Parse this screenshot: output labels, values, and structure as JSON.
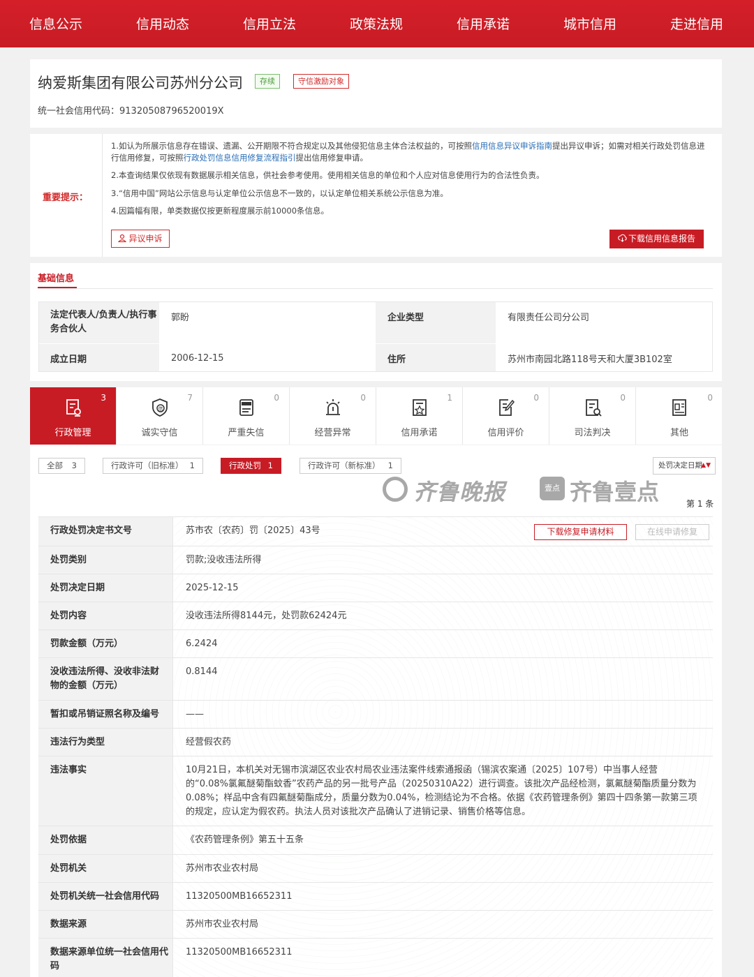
{
  "nav": [
    "信息公示",
    "信用动态",
    "信用立法",
    "政策法规",
    "信用承诺",
    "城市信用",
    "走进信用"
  ],
  "company": {
    "name": "纳爱斯集团有限公司苏州分公司",
    "status_tag": "存续",
    "incentive_tag": "守信激励对象",
    "credit_code_label": "统一社会信用代码：",
    "credit_code": "91320508796520019X"
  },
  "notice": {
    "title": "重要提示：",
    "line1_a": "1.如认为所展示信息存在错误、遗漏、公开期限不符合规定以及其他侵犯信息主体合法权益的，可按照",
    "line1_link": "信用信息异议申诉指南",
    "line1_b": "提出异议申诉；如需对相关行政处罚信息进行信用修复，可按照",
    "line1_link2": "行政处罚信息信用修复流程指引",
    "line1_c": "提出信用修复申请。",
    "line2": "2.本查询结果仅依现有数据展示相关信息，供社会参考使用。使用相关信息的单位和个人应对信息使用行为的合法性负责。",
    "line3": "3.“信用中国”网站公示信息与认定单位公示信息不一致的，以认定单位相关系统公示信息为准。",
    "line4": "4.因篇幅有限，单类数据仅按更新程度展示前10000条信息。",
    "appeal_button": "异议申诉",
    "download_button": "下载信用信息报告"
  },
  "basic": {
    "title": "基础信息",
    "legal_rep_label": "法定代表人/负责人/执行事务合伙人",
    "legal_rep": "郭盼",
    "type_label": "企业类型",
    "type": "有限责任公司分公司",
    "founded_label": "成立日期",
    "founded": "2006-12-15",
    "address_label": "住所",
    "address": "苏州市南园北路118号天和大厦3B102室"
  },
  "categories": [
    {
      "label": "行政管理",
      "count": "3",
      "icon": "document-stamp-icon"
    },
    {
      "label": "诚实守信",
      "count": "7",
      "icon": "shield-credit-icon"
    },
    {
      "label": "严重失信",
      "count": "0",
      "icon": "dishonest-person-icon"
    },
    {
      "label": "经营异常",
      "count": "0",
      "icon": "alarm-light-icon"
    },
    {
      "label": "信用承诺",
      "count": "1",
      "icon": "promise-document-icon"
    },
    {
      "label": "信用评价",
      "count": "0",
      "icon": "evaluation-icon"
    },
    {
      "label": "司法判决",
      "count": "0",
      "icon": "judgment-icon"
    },
    {
      "label": "其他",
      "count": "0",
      "icon": "other-icon"
    }
  ],
  "filters": {
    "all_label": "全部",
    "all_count": "3",
    "old_label": "行政许可（旧标准）",
    "old_count": "1",
    "penalty_label": "行政处罚",
    "penalty_count": "1",
    "new_label": "行政许可（新标准）",
    "new_count": "1",
    "sort": "处罚决定日期"
  },
  "watermark": {
    "brand1": "齐鲁晚报",
    "box": "壹点",
    "brand2": "齐鲁壹点"
  },
  "page_count": "第 1 条",
  "detail": {
    "download_repair": "下载修复申请材料",
    "online_repair": "在线申请修复",
    "rows": [
      {
        "label": "行政处罚决定书文号",
        "value": "苏市农〔农药〕罚〔2025〕43号"
      },
      {
        "label": "处罚类别",
        "value": "罚款;没收违法所得"
      },
      {
        "label": "处罚决定日期",
        "value": "2025-12-15"
      },
      {
        "label": "处罚内容",
        "value": "没收违法所得8144元，处罚款62424元"
      },
      {
        "label": "罚款金额（万元）",
        "value": "6.2424"
      },
      {
        "label": "没收违法所得、没收非法财物的金额（万元）",
        "value": "0.8144"
      },
      {
        "label": "暂扣或吊销证照名称及编号",
        "value": "——"
      },
      {
        "label": "违法行为类型",
        "value": "经营假农药"
      },
      {
        "label": "违法事实",
        "value": "10月21日，本机关对无锡市滨湖区农业农村局农业违法案件线索通报函（锡滨农案通〔2025〕107号）中当事人经营的“0.08%氯氟醚菊酯蚊香”农药产品的另一批号产品（20250310A22）进行调查。该批次产品经检测，氯氟醚菊酯质量分数为0.08%；样品中含有四氟醚菊酯成分，质量分数为0.04%，检测结论为不合格。依据《农药管理条例》第四十四条第一款第三项的规定，应认定为假农药。执法人员对该批次产品确认了进销记录、销售价格等信息。"
      },
      {
        "label": "处罚依据",
        "value": "《农药管理条例》第五十五条"
      },
      {
        "label": "处罚机关",
        "value": "苏州市农业农村局"
      },
      {
        "label": "处罚机关统一社会信用代码",
        "value": "11320500MB16652311"
      },
      {
        "label": "数据来源",
        "value": "苏州市农业农村局"
      },
      {
        "label": "数据来源单位统一社会信用代码",
        "value": "11320500MB16652311"
      }
    ]
  }
}
